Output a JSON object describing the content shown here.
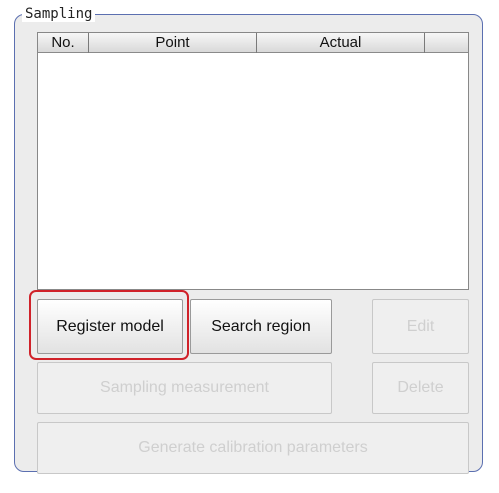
{
  "group": {
    "title": "Sampling"
  },
  "table": {
    "columns": [
      "No.",
      "Point",
      "Actual",
      ""
    ]
  },
  "buttons": {
    "register_model": "Register model",
    "search_region": "Search region",
    "edit": "Edit",
    "sampling_measurement": "Sampling measurement",
    "delete": "Delete",
    "generate_calibration": "Generate calibration parameters"
  },
  "colors": {
    "highlight": "#d0222a",
    "group_border": "#5b6fb0"
  }
}
